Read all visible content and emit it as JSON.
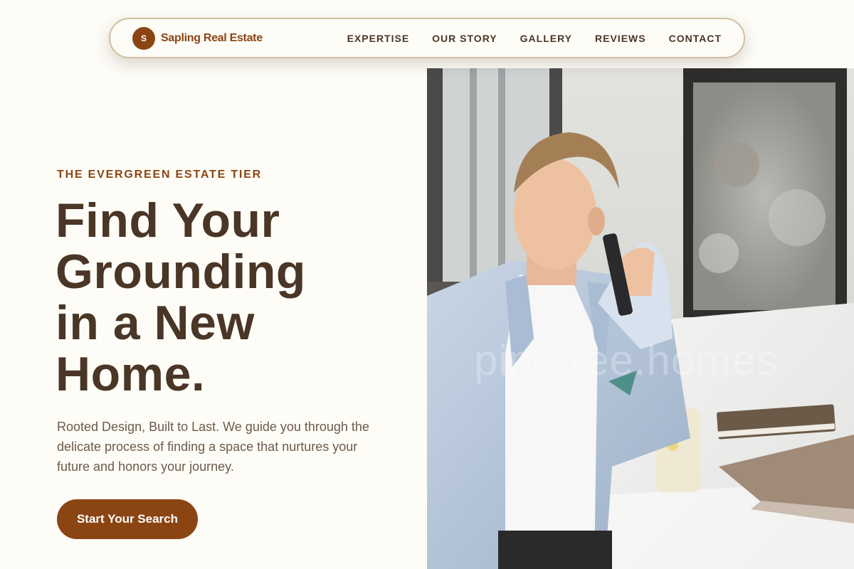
{
  "brand": {
    "mark": "S",
    "name": "Sapling Real Estate"
  },
  "nav": {
    "links": [
      "EXPERTISE",
      "OUR STORY",
      "GALLERY",
      "REVIEWS",
      "CONTACT"
    ]
  },
  "hero": {
    "eyebrow": "THE EVERGREEN ESTATE TIER",
    "headline_lines": [
      "Find Your",
      "Grounding",
      "in a New",
      "Home."
    ],
    "lede": "Rooted Design, Built to Last. We guide you through the delicate process of finding a space that nurtures your future and honors your journey.",
    "cta_label": "Start Your Search",
    "image_watermark": "pinetree.homes"
  },
  "colors": {
    "background": "#fdfcf6",
    "accent": "#8b4513",
    "heading": "#4a3626",
    "body_text": "#6e5a4a",
    "nav_border": "#d2bfa0"
  },
  "icons": {
    "brand_mark": "sapling-logo-icon"
  }
}
